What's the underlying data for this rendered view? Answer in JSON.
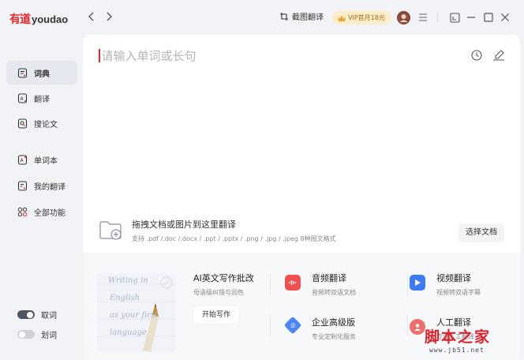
{
  "app": {
    "logo_cn": "有道",
    "logo_en": "youdao",
    "screenshot_translate": "截图翻译",
    "vip_label": "VIP首月18元"
  },
  "colors": {
    "brand_red": "#e4262d",
    "toggle_on": "#4e5563",
    "toggle_off": "#cfd2d8"
  },
  "sidebar": {
    "items": [
      {
        "label": "词典",
        "icon": "dictionary-icon",
        "active": true
      },
      {
        "label": "翻译",
        "icon": "translate-icon",
        "active": false
      },
      {
        "label": "搜论文",
        "icon": "search-paper-icon",
        "active": false
      },
      {
        "label": "单词本",
        "icon": "wordbook-icon",
        "active": false
      },
      {
        "label": "我的翻译",
        "icon": "my-translation-icon",
        "active": false
      },
      {
        "label": "全部功能",
        "icon": "all-features-icon",
        "active": false
      }
    ],
    "toggles": [
      {
        "label": "取词",
        "on": true
      },
      {
        "label": "划词",
        "on": false
      }
    ]
  },
  "main": {
    "input_placeholder": "请输入单词或长句",
    "drop_title": "拖拽文档或图片到这里翻译",
    "drop_sub": "支持 .pdf /.doc /.docx / .ppt / .pptx / .png / .jpg / .jpeg 8种图文格式",
    "choose_doc": "选择文档"
  },
  "features": {
    "ai_writing": {
      "title": "AI英文写作批改",
      "sub": "母语级纠错与润色",
      "button": "开始写作",
      "sample": [
        "Writing in",
        "English",
        "as your first",
        "language"
      ]
    },
    "audio": {
      "title": "音频翻译",
      "sub": "音频转双语文档"
    },
    "video": {
      "title": "视频翻译",
      "sub": "视频转双语字幕"
    },
    "enterprise": {
      "title": "企业高级版",
      "sub": "专业定制化服务"
    },
    "human": {
      "title": "人工翻译",
      "sub": "专业人工翻译"
    }
  },
  "watermark": {
    "text": "脚本之家",
    "url": "www.jb51.net"
  }
}
